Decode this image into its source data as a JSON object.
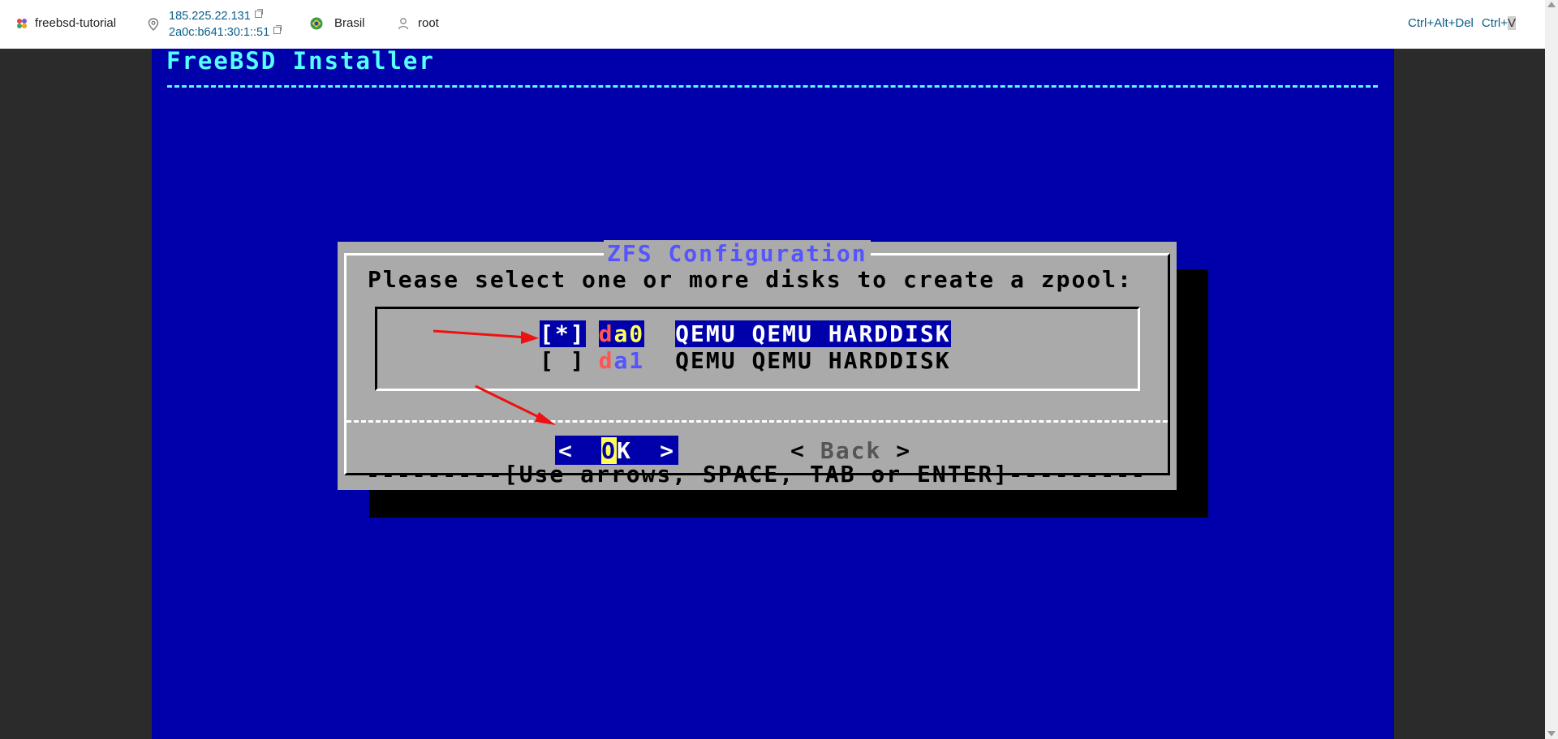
{
  "topbar": {
    "hostname": "freebsd-tutorial",
    "ipv4": "185.225.22.131",
    "ipv6": "2a0c:b641:30:1::51",
    "location": "Brasil",
    "user": "root",
    "ctrl_alt_del": "Ctrl+Alt+Del",
    "ctrl_v_prefix": "Ctrl+",
    "ctrl_v_key": "V"
  },
  "console": {
    "installer_title": "FreeBSD Installer",
    "dialog": {
      "title": "ZFS Configuration",
      "prompt": "Please select one or more disks to create a zpool:",
      "disks": [
        {
          "check": "[*]",
          "name_first": "d",
          "name_rest": "a0",
          "description": "QEMU QEMU HARDDISK",
          "selected": true
        },
        {
          "check": "[ ]",
          "name_first": "d",
          "name_rest": "a1",
          "description": "QEMU QEMU HARDDISK",
          "selected": false
        }
      ],
      "ok_left": "<",
      "ok_first": "O",
      "ok_rest": "K",
      "ok_right": ">",
      "back_left": "<",
      "back_label": "Back",
      "back_right": ">",
      "hint": "---------[Use arrows, SPACE, TAB or ENTER]---------"
    }
  },
  "colors": {
    "console_bg": "#0000aa",
    "title_cyan": "#55ffff",
    "dialog_bg": "#aaaaaa",
    "dialog_title": "#5555ff",
    "disk_letter_red": "#ff5555",
    "highlight_yellow": "#ffff55",
    "annotation_red": "#ee1111"
  }
}
